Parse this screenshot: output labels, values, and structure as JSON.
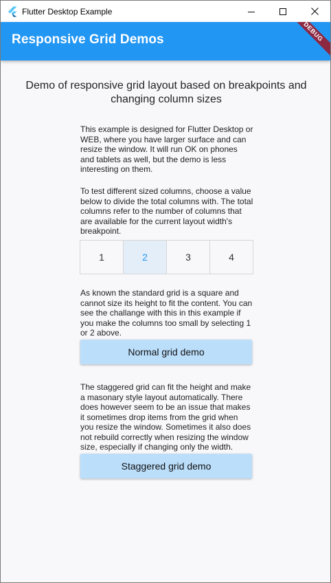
{
  "window": {
    "title": "Flutter Desktop Example"
  },
  "appbar": {
    "title": "Responsive Grid Demos",
    "debug_label": "DEBUG",
    "color": "#2196f3"
  },
  "content": {
    "headline": "Demo of responsive grid layout based on breakpoints and changing column sizes",
    "intro": "This example is designed for Flutter Desktop or WEB, where you have larger surface and can resize the window. It will run OK on phones and tablets as well, but the demo is less interesting on them.",
    "columns_instructions": "To test different sized columns, choose a value below to divide the total columns with. The total columns refer to the number of columns that are available for the current layout width's breakpoint.",
    "column_options": [
      "1",
      "2",
      "3",
      "4"
    ],
    "selected_column": "2",
    "normal_grid_text": "As known the standard grid is a square and cannot size its height to fit the content. You can see the challange with this in this example if you make the columns too small by selecting 1 or 2 above.",
    "normal_grid_button": "Normal grid demo",
    "staggered_grid_text": "The staggered grid can fit the height and make a masonary style layout automatically. There does however seem to be an issue that makes it sometimes drop items from the grid when you resize the window. Sometimes it also does not rebuild correctly when resizing the window size, especially if changing only the width.",
    "staggered_grid_button": "Staggered grid demo"
  }
}
